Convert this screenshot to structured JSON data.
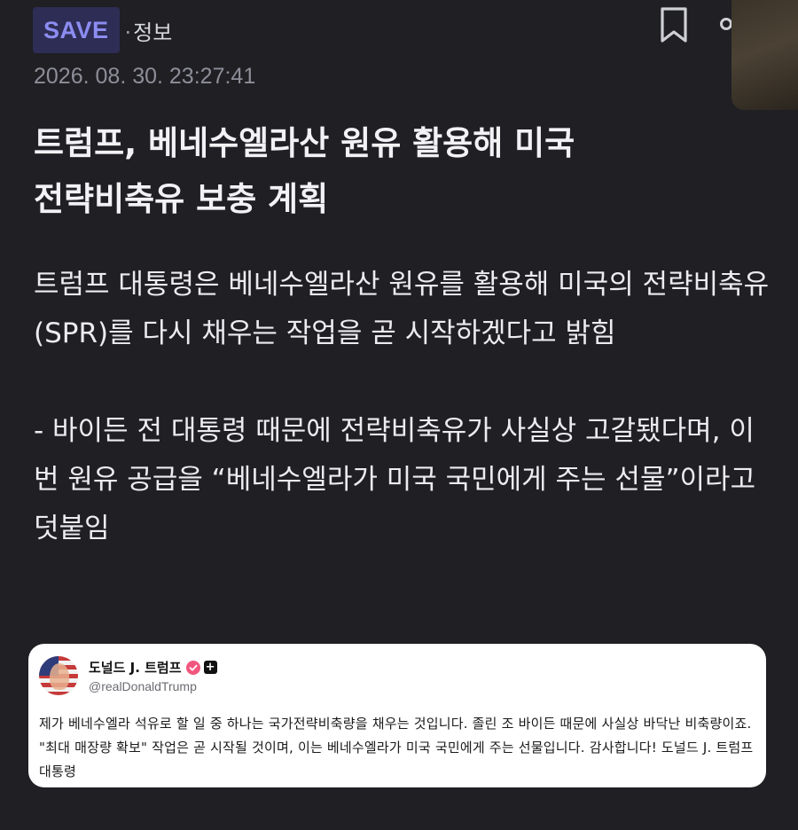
{
  "header": {
    "save_label": "SAVE",
    "category_dot": "·",
    "category": "정보",
    "bookmark_icon": "bookmark-icon",
    "more_icon": "more-icon"
  },
  "article": {
    "date": "2026. 08. 30. 23:27:41",
    "title_line1": "트럼프, 베네수엘라산 원유 활용해 미국",
    "title_line2": "전략비축유 보충 계획",
    "body_p1": "트럼프 대통령은 베네수엘라산 원유를 활용해 미국의 전략비축유(SPR)를 다시 채우는 작업을 곧 시작하겠다고 밝힘",
    "body_p2": "- 바이든 전 대통령 때문에 전략비축유가 사실상 고갈됐다며, 이번 원유 공급을 “베네수엘라가 미국 국민에게 주는 선물”이라고 덧붙임"
  },
  "tweet": {
    "name": "도널드 J. 트럼프",
    "verified_icon": "verified-icon",
    "plus_symbol": "+",
    "handle": "@realDonaldTrump",
    "text": "제가 베네수엘라 석유로 할 일 중 하나는 국가전략비축량을 채우는 것입니다. 졸린 조 바이든 때문에 사실상 바닥난 비축량이죠. \"최대 매장량 확보\" 작업은 곧 시작될 것이며, 이는 베네수엘라가 미국 국민에게 주는 선물입니다. 감사합니다! 도널드 J. 트럼프 대통령"
  },
  "colors": {
    "background": "#1f1f24",
    "save_badge_bg": "#2d2d55",
    "save_badge_text": "#8c8cf2",
    "date_text": "#8e8e99",
    "verified": "#f0567e"
  }
}
